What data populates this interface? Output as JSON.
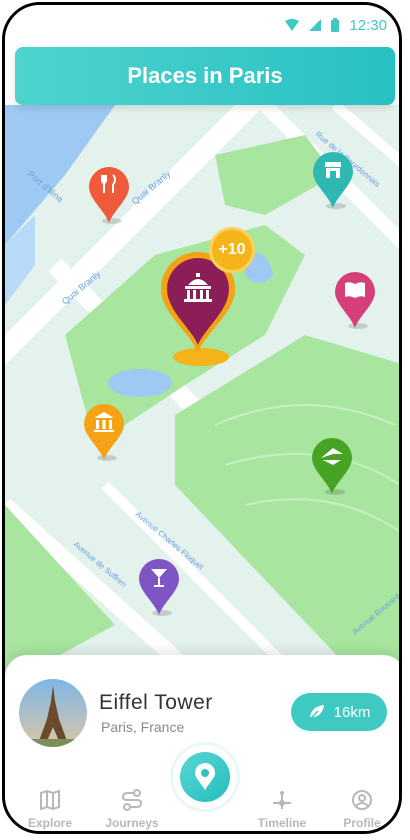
{
  "status": {
    "time": "12:30"
  },
  "header": {
    "title": "Places in Paris"
  },
  "map": {
    "streets": [
      "Port d'Iéna",
      "Quai Branly",
      "Quai Branly",
      "Rue de la Bourdonnais",
      "Avenue Charles Floquet",
      "Avenue de Suffren",
      "Avenue Bouvard"
    ],
    "pins": [
      {
        "name": "restaurant",
        "color": "#ee5a3a",
        "icon": "fork-knife-icon"
      },
      {
        "name": "shop",
        "color": "#2fb7b1",
        "icon": "shop-icon"
      },
      {
        "name": "monument",
        "color": "#8b1d57",
        "icon": "monument-icon",
        "badge": "+10"
      },
      {
        "name": "library",
        "color": "#d6407a",
        "icon": "book-icon"
      },
      {
        "name": "museum",
        "color": "#f5a214",
        "icon": "museum-icon"
      },
      {
        "name": "park",
        "color": "#47a324",
        "icon": "park-icon"
      },
      {
        "name": "bar",
        "color": "#7f54c4",
        "icon": "cocktail-icon"
      }
    ]
  },
  "place": {
    "name": "Eiffel Tower",
    "location": "Paris, France",
    "distance": "16km"
  },
  "nav": {
    "items": [
      {
        "label": "Explore",
        "icon": "map-icon"
      },
      {
        "label": "Journeys",
        "icon": "route-icon"
      },
      {
        "label": "Timeline",
        "icon": "timeline-icon"
      },
      {
        "label": "Profile",
        "icon": "user-icon"
      }
    ],
    "center_icon": "location-pin-icon"
  },
  "colors": {
    "accent": "#3ec9c3",
    "park": "#a8e6a0",
    "water": "#9ec9f3",
    "land": "#e6f4ef"
  }
}
